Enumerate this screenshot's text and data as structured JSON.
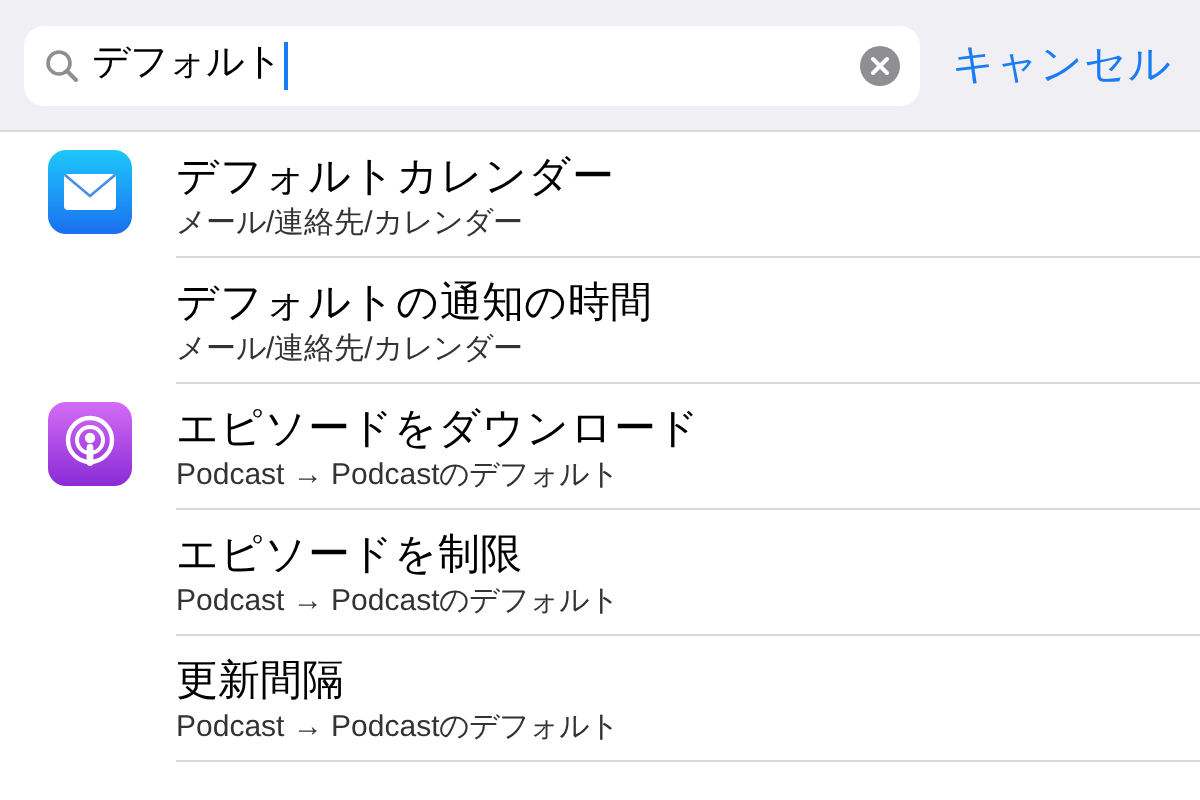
{
  "search": {
    "value": "デフォルト",
    "cancel": "キャンセル"
  },
  "groups": [
    {
      "rows": [
        {
          "title": "デフォルトカレンダー",
          "subtitle": "メール/連絡先/カレンダー"
        },
        {
          "title": "デフォルトの通知の時間",
          "subtitle": "メール/連絡先/カレンダー"
        }
      ]
    },
    {
      "rows": [
        {
          "title": "エピソードをダウンロード",
          "subtitle": "Podcast → Podcastのデフォルト"
        },
        {
          "title": "エピソードを制限",
          "subtitle": "Podcast → Podcastのデフォルト"
        },
        {
          "title": "更新間隔",
          "subtitle": "Podcast → Podcastのデフォルト"
        }
      ]
    }
  ]
}
